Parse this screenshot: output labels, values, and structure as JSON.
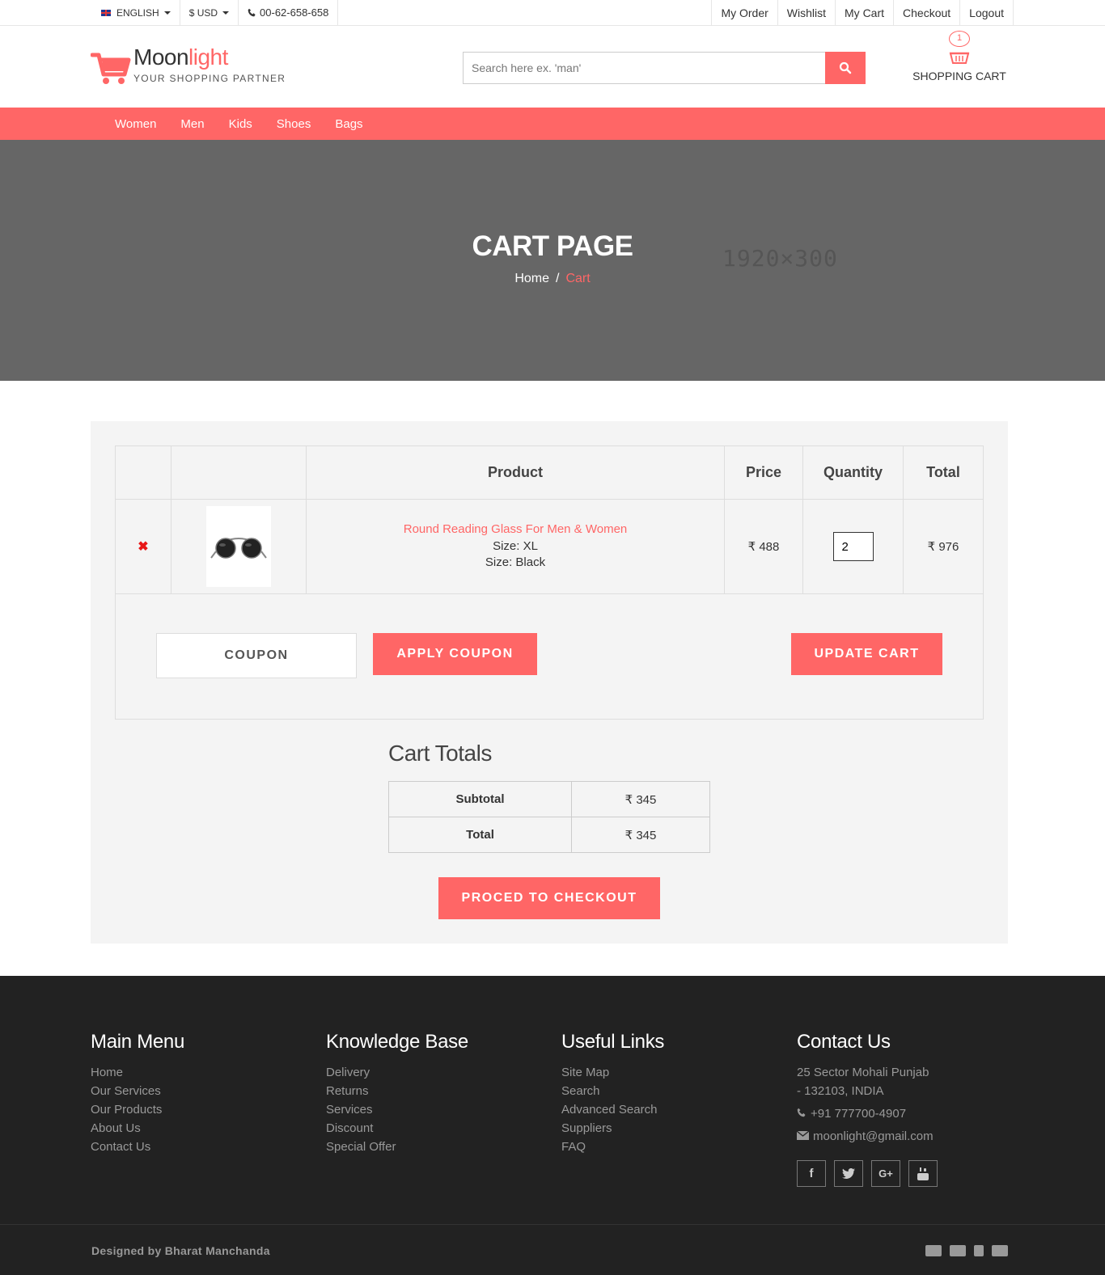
{
  "topbar": {
    "language": "ENGLISH",
    "currency": "$ USD",
    "phone": "00-62-658-658",
    "links": [
      "My Order",
      "Wishlist",
      "My Cart",
      "Checkout",
      "Logout"
    ]
  },
  "header": {
    "brand_part1": "Moon",
    "brand_part2": "light",
    "tagline": "YOUR SHOPPING PARTNER",
    "search_placeholder": "Search here ex. 'man'",
    "cart_count": "1",
    "cart_label": "SHOPPING CART"
  },
  "nav": [
    "Women",
    "Men",
    "Kids",
    "Shoes",
    "Bags"
  ],
  "hero": {
    "title": "CART PAGE",
    "crumb_home": "Home",
    "crumb_sep": "/",
    "crumb_current": "Cart",
    "placeholder_size": "1920×300"
  },
  "cart": {
    "columns": [
      "",
      "",
      "Product",
      "Price",
      "Quantity",
      "Total"
    ],
    "items": [
      {
        "remove": "✖",
        "name": "Round Reading Glass For Men & Women",
        "size": "Size: XL",
        "color": "Size: Black",
        "price": "₹ 488",
        "quantity": "2",
        "total": "₹ 976"
      }
    ],
    "coupon_placeholder": "COUPON",
    "apply_label": "APPLY COUPON",
    "update_label": "UPDATE CART"
  },
  "totals": {
    "title": "Cart Totals",
    "rows": [
      {
        "label": "Subtotal",
        "value": "₹ 345"
      },
      {
        "label": "Total",
        "value": "₹ 345"
      }
    ],
    "checkout_label": "PROCED TO CHECKOUT"
  },
  "footer": {
    "main_menu": {
      "title": "Main Menu",
      "items": [
        "Home",
        "Our Services",
        "Our Products",
        "About Us",
        "Contact Us"
      ]
    },
    "knowledge": {
      "title": "Knowledge Base",
      "items": [
        "Delivery",
        "Returns",
        "Services",
        "Discount",
        "Special Offer"
      ]
    },
    "useful": {
      "title": "Useful Links",
      "items": [
        "Site Map",
        "Search",
        "Advanced Search",
        "Suppliers",
        "FAQ"
      ]
    },
    "contact": {
      "title": "Contact Us",
      "address1": "25 Sector Mohali Punjab",
      "address2": "- 132103, INDIA",
      "phone": "+91 777700-4907",
      "email": "moonlight@gmail.com"
    },
    "socials": [
      "facebook-icon",
      "twitter-icon",
      "google-plus-icon",
      "youtube-icon"
    ],
    "credit": "Designed by Bharat Manchanda",
    "payments": [
      "mastercard-icon",
      "visa-icon",
      "paypal-icon",
      "amex-icon"
    ],
    "accent_color": "#ff6666"
  }
}
